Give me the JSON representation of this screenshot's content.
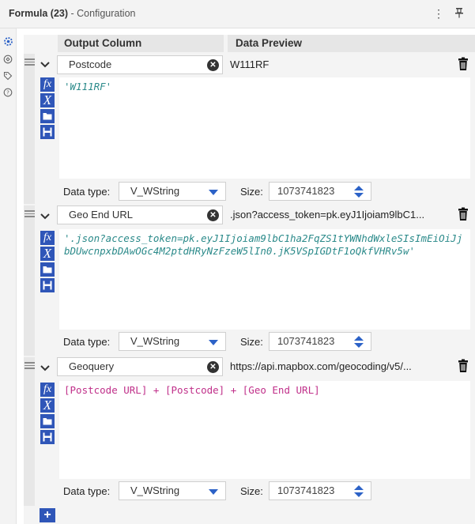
{
  "window": {
    "title": "Formula (23)",
    "subtitle": "- Configuration"
  },
  "nav_icons": [
    "gear-icon",
    "config-icon",
    "tag-icon",
    "help-icon"
  ],
  "columns": {
    "output": "Output Column",
    "preview": "Data Preview"
  },
  "rows": [
    {
      "name": "Postcode",
      "preview": "W111RF",
      "expression": "'W111RF'",
      "data_type_label": "Data type:",
      "data_type": "V_WString",
      "size_label": "Size:",
      "size": "1073741823"
    },
    {
      "name": "Geo End URL",
      "preview": ".json?access_token=pk.eyJ1Ijoiam9lbC1...",
      "expression": "'.json?access_token=pk.eyJ1Ijoiam9lbC1ha2FqZS1tYWNhdWxleSIsImEiOiJjbDUwcnpxbDAwOGc4M2ptdHRyNzFzeW5lIn0.jK5VSpIGDtF1oQkfVHRv5w'",
      "data_type_label": "Data type:",
      "data_type": "V_WString",
      "size_label": "Size:",
      "size": "1073741823"
    },
    {
      "name": "Geoquery",
      "preview": "https://api.mapbox.com/geocoding/v5/...",
      "expression_parts": [
        "[Postcode URL]",
        " + ",
        "[Postcode]",
        " + ",
        "[Geo End URL]"
      ],
      "data_type_label": "Data type:",
      "data_type": "V_WString",
      "size_label": "Size:",
      "size": "1073741823"
    }
  ],
  "colors": {
    "accent": "#2c62c7",
    "tool_blue": "#2f56b8",
    "expr_string": "#2b8a8a",
    "expr_field": "#c0308a"
  }
}
